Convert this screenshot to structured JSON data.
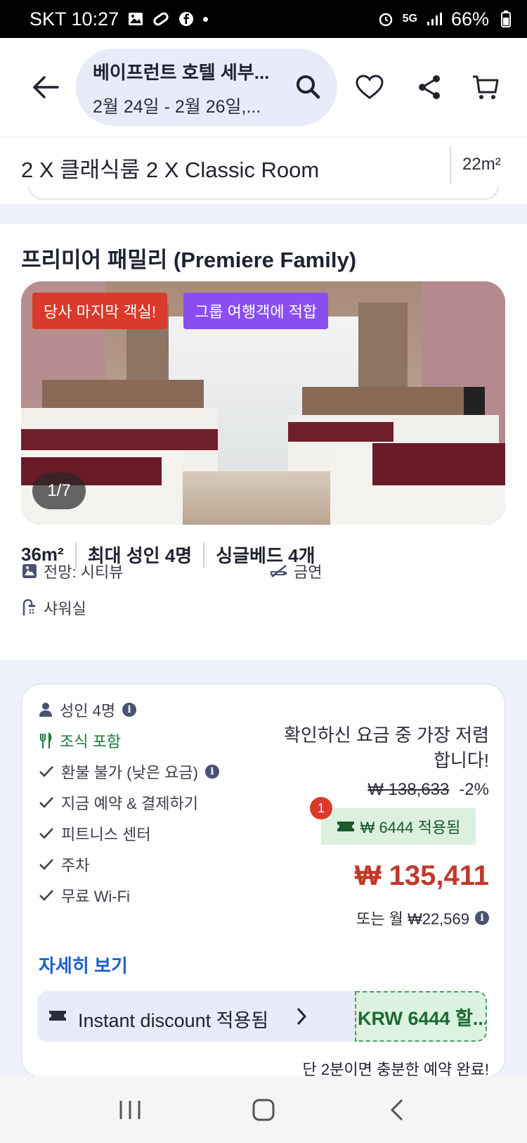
{
  "status_bar": {
    "carrier_time": "SKT 10:27",
    "network": "5G",
    "battery": "66%"
  },
  "header": {
    "hotel_name": "베이프런트 호텔 세부...",
    "dates": "2월 24일 - 2월 26일,...",
    "icons": [
      "back-arrow-icon",
      "search-icon",
      "heart-icon",
      "share-icon",
      "cart-icon"
    ]
  },
  "previous_room": {
    "title": "2 X 클래식룸 2 X Classic Room",
    "size": "22m²"
  },
  "room": {
    "name": "프리미어 패밀리 (Premiere Family)",
    "badges": {
      "last_room": "당사 마지막 객실!",
      "group": "그룹 여행객에 적합"
    },
    "photo_counter": "1/7",
    "specs": {
      "size": "36m²",
      "max_adults": "최대 성인 4명",
      "beds": "싱글베드 4개"
    },
    "amenities": {
      "view": "전망: 시티뷰",
      "smoking": "금연",
      "shower": "샤워실"
    }
  },
  "rate": {
    "features": {
      "adults": "성인 4명",
      "breakfast": "조식 포함",
      "refund": "환불 불가 (낮은 요금)",
      "pay": "지금 예약 & 결제하기",
      "fitness": "피트니스 센터",
      "parking": "주차",
      "wifi": "무료 Wi-Fi"
    },
    "more_link": "자세히 보기",
    "cheapest_note": "확인하신 요금 중 가장 저렴합니다!",
    "original_price": "₩ 138,633",
    "discount_pct": "-2%",
    "coupon_count": "1",
    "coupon_text": "₩ 6444 적용됨",
    "price": "₩ 135,411",
    "monthly": "또는 월 ₩22,569",
    "instant_discount": "Instant discount 적용됨",
    "discount_tag": "KRW 6444 할...",
    "booking_note": "단 2분이면 충분한 예약 완료!"
  },
  "colors": {
    "accent_blue": "#1a5fd0",
    "price_red": "#c0392b",
    "green": "#1b7a3a",
    "badge_purple": "#8a4ef0",
    "badge_red": "#d93a2b"
  }
}
